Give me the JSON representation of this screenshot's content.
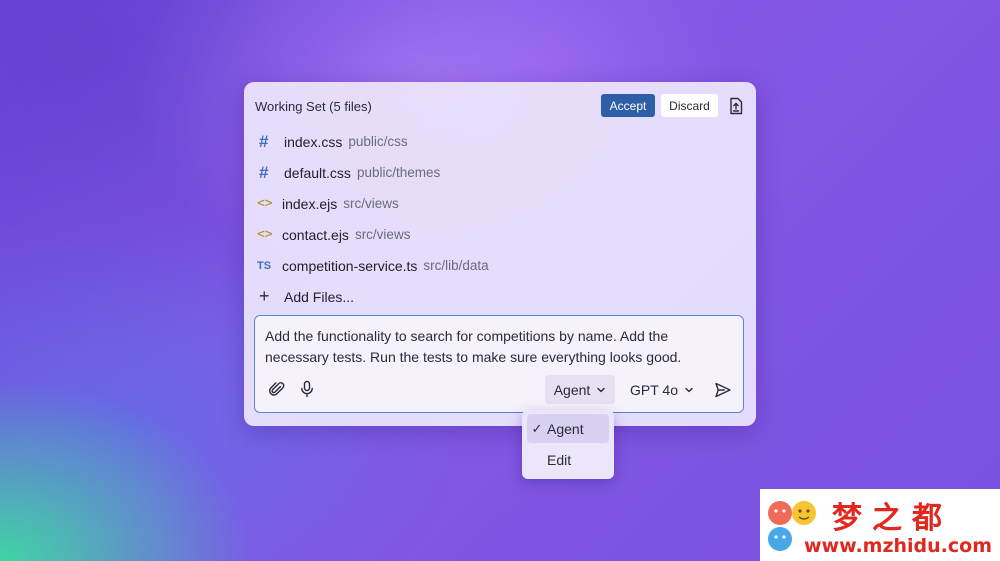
{
  "working_set": {
    "title": "Working Set (5 files)",
    "accept_label": "Accept",
    "discard_label": "Discard",
    "save_icon": "save-to-file-icon",
    "files": [
      {
        "icon": "hash-icon",
        "name": "index.css",
        "path": "public/css"
      },
      {
        "icon": "hash-icon",
        "name": "default.css",
        "path": "public/themes"
      },
      {
        "icon": "code-icon",
        "name": "index.ejs",
        "path": "src/views"
      },
      {
        "icon": "code-icon",
        "name": "contact.ejs",
        "path": "src/views"
      },
      {
        "icon": "ts-icon",
        "icon_text": "TS",
        "name": "competition-service.ts",
        "path": "src/lib/data"
      }
    ],
    "add_files_label": "Add Files..."
  },
  "chat_input": {
    "value": "Add the functionality to search for competitions by name. Add the necessary tests. Run the tests to make sure everything looks good.",
    "mode": "Agent",
    "model": "GPT 4o"
  },
  "mode_dropdown": {
    "options": [
      {
        "label": "Agent",
        "selected": true
      },
      {
        "label": "Edit",
        "selected": false
      }
    ]
  },
  "watermark": {
    "chinese_text": "梦之都",
    "url": "www.mzhidu.com"
  },
  "colors": {
    "accent": "#2f5ea8",
    "css_icon": "#3d6fc0",
    "ejs_icon": "#a89020",
    "watermark_red": "#e0281e"
  }
}
